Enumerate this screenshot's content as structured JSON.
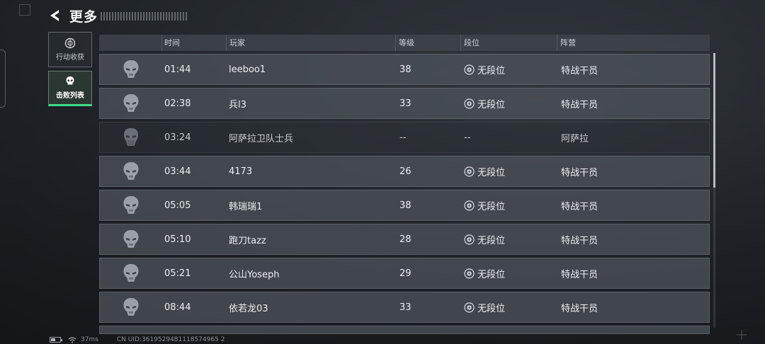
{
  "header": {
    "title": "更多"
  },
  "sidebar": {
    "items": [
      {
        "label": "行动收获",
        "icon": "target-icon",
        "active": false
      },
      {
        "label": "击败列表",
        "icon": "skull-icon",
        "active": true
      }
    ]
  },
  "table": {
    "columns": [
      "时间",
      "玩家",
      "等级",
      "段位",
      "阵营"
    ],
    "rows": [
      {
        "time": "01:44",
        "player": "leeboo1",
        "level": "38",
        "rank": "无段位",
        "faction": "特战干员"
      },
      {
        "time": "02:38",
        "player": "兵l3",
        "level": "33",
        "rank": "无段位",
        "faction": "特战干员"
      },
      {
        "time": "03:24",
        "player": "阿萨拉卫队士兵",
        "level": "--",
        "rank": "--",
        "faction": "阿萨拉"
      },
      {
        "time": "03:44",
        "player": "4173",
        "level": "26",
        "rank": "无段位",
        "faction": "特战干员"
      },
      {
        "time": "05:05",
        "player": "韩瑞瑞1",
        "level": "38",
        "rank": "无段位",
        "faction": "特战干员"
      },
      {
        "time": "05:10",
        "player": "跑刀tazz",
        "level": "28",
        "rank": "无段位",
        "faction": "特战干员"
      },
      {
        "time": "05:21",
        "player": "公山Yoseph",
        "level": "29",
        "rank": "无段位",
        "faction": "特战干员"
      },
      {
        "time": "08:44",
        "player": "依若龙03",
        "level": "33",
        "rank": "无段位",
        "faction": "特战干员"
      }
    ]
  },
  "footer": {
    "ping": "37ms",
    "uid": "CN UID:3619529481118574965 2"
  },
  "colors": {
    "accent": "#3fdb8a"
  }
}
